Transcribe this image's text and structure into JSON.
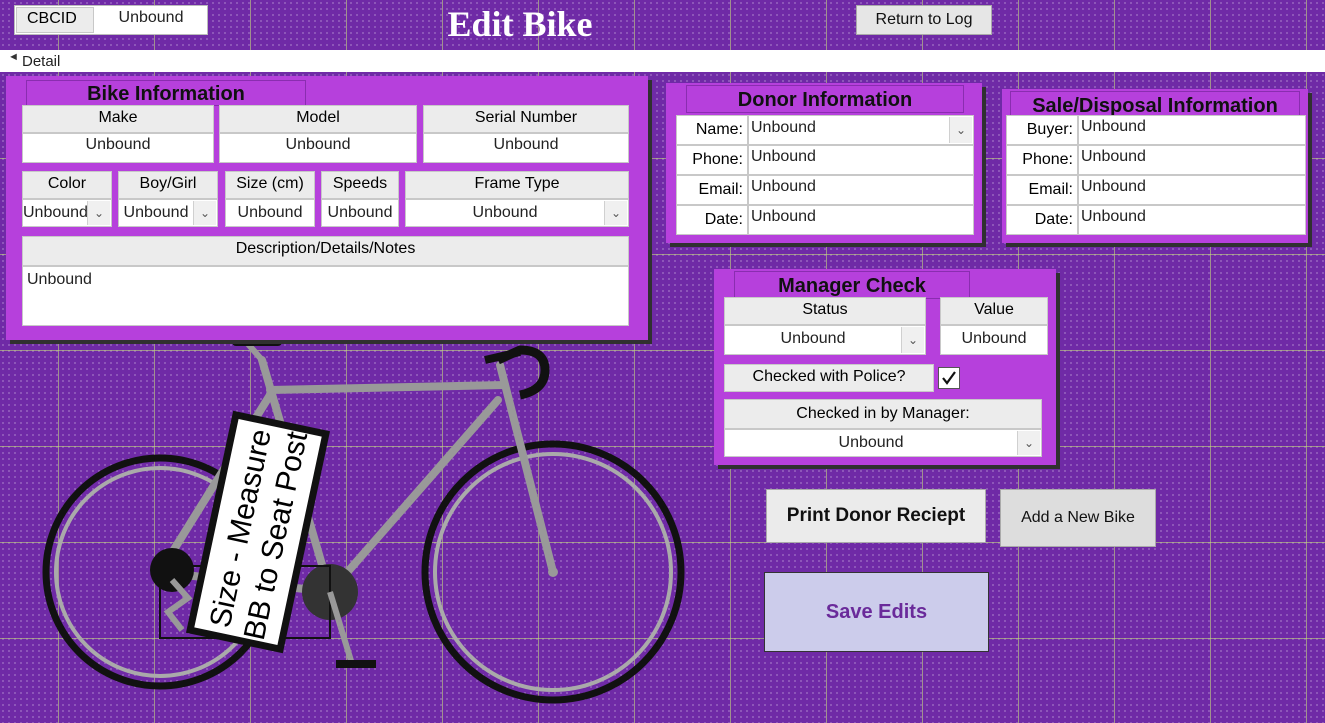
{
  "header": {
    "cbcid_label": "CBCID",
    "cbcid_value": "Unbound",
    "title": "Edit Bike",
    "return_button": "Return to Log",
    "section_label": "Detail"
  },
  "bike_info": {
    "title": "Bike Information",
    "make_label": "Make",
    "make_value": "Unbound",
    "model_label": "Model",
    "model_value": "Unbound",
    "serial_label": "Serial Number",
    "serial_value": "Unbound",
    "color_label": "Color",
    "color_value": "Unbound",
    "boygirl_label": "Boy/Girl",
    "boygirl_value": "Unbound",
    "size_label": "Size (cm)",
    "size_value": "Unbound",
    "speeds_label": "Speeds",
    "speeds_value": "Unbound",
    "frame_label": "Frame Type",
    "frame_value": "Unbound",
    "desc_label": "Description/Details/Notes",
    "desc_value": "Unbound"
  },
  "donor_info": {
    "title": "Donor Information",
    "name_label": "Name:",
    "name_value": "Unbound",
    "phone_label": "Phone:",
    "phone_value": "Unbound",
    "email_label": "Email:",
    "email_value": "Unbound",
    "date_label": "Date:",
    "date_value": "Unbound"
  },
  "sale_info": {
    "title": "Sale/Disposal Information",
    "buyer_label": "Buyer:",
    "buyer_value": "Unbound",
    "phone_label": "Phone:",
    "phone_value": "Unbound",
    "email_label": "Email:",
    "email_value": "Unbound",
    "date_label": "Date:",
    "date_value": "Unbound"
  },
  "manager_check": {
    "title": "Manager Check",
    "status_label": "Status",
    "status_value": "Unbound",
    "value_label": "Value",
    "value_value": "Unbound",
    "police_label": "Checked with Police?",
    "police_checked": true,
    "manager_label": "Checked in by Manager:",
    "manager_value": "Unbound"
  },
  "actions": {
    "print_receipt": "Print Donor Reciept",
    "add_bike": "Add a New Bike",
    "save_edits": "Save Edits"
  },
  "bike_image": {
    "sign_line1": "Size - Measure",
    "sign_line2": "BB to Seat Post"
  },
  "colors": {
    "background": "#6f2aa6",
    "panel": "#b640dc",
    "save_button_bg": "#cccceb",
    "save_button_text": "#6a2a9a"
  }
}
